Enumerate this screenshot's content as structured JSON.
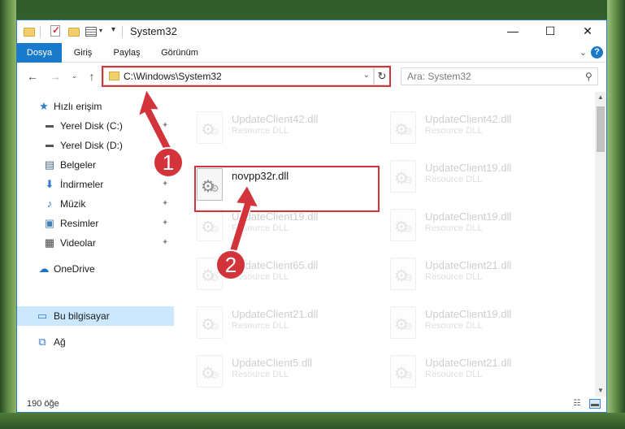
{
  "window": {
    "title": "System32"
  },
  "quick_access_toolbar": {
    "icons": [
      "folder-icon",
      "properties-check-icon",
      "new-folder-icon",
      "properties-list-icon",
      "customize-dropdown-icon"
    ]
  },
  "window_controls": {
    "minimize": "—",
    "maximize": "☐",
    "close": "✕"
  },
  "ribbon": {
    "tabs": [
      {
        "label": "Dosya",
        "active": true
      },
      {
        "label": "Giriş"
      },
      {
        "label": "Paylaş"
      },
      {
        "label": "Görünüm"
      }
    ],
    "expand_chevron": "⌄",
    "help_icon": "?"
  },
  "navigation": {
    "back": "←",
    "forward": "→",
    "recent": "⌄",
    "up": "↑",
    "address_path": "C:\\Windows\\System32",
    "address_dropdown": "⌄",
    "refresh": "↻",
    "search_placeholder": "Ara: System32",
    "search_icon": "⚲"
  },
  "sidebar": {
    "items": [
      {
        "label": "Hızlı erişim",
        "icon": "★",
        "icon_color": "#2e7bd1",
        "pinned": false
      },
      {
        "label": "Yerel Disk (C:)",
        "icon": "▬",
        "icon_color": "#555555",
        "pinned": true
      },
      {
        "label": "Yerel Disk (D:)",
        "icon": "▬",
        "icon_color": "#555555",
        "pinned": true
      },
      {
        "label": "Belgeler",
        "icon": "▤",
        "icon_color": "#4a6a8e",
        "pinned": true
      },
      {
        "label": "İndirmeler",
        "icon": "⬇",
        "icon_color": "#2e7bd1",
        "pinned": true
      },
      {
        "label": "Müzik",
        "icon": "♪",
        "icon_color": "#2e7bd1",
        "pinned": true
      },
      {
        "label": "Resimler",
        "icon": "▣",
        "icon_color": "#4a7fb5",
        "pinned": true
      },
      {
        "label": "Videolar",
        "icon": "▦",
        "icon_color": "#444444",
        "pinned": true
      },
      {
        "label": "OneDrive",
        "icon": "☁",
        "icon_color": "#1e6fc8",
        "pinned": false
      },
      {
        "label": "Bu bilgisayar",
        "icon": "▭",
        "icon_color": "#2e7bd1",
        "pinned": false,
        "selected": true
      },
      {
        "label": "Ağ",
        "icon": "⧉",
        "icon_color": "#2e7bd1",
        "pinned": false
      }
    ],
    "pin_glyph": "📌"
  },
  "files": [
    {
      "name": "UpdateClient42.dll",
      "type": "Resource DLL",
      "faded": true
    },
    {
      "name": "UpdateClient42.dll",
      "type": "Resource DLL",
      "faded": true
    },
    {
      "name": "novpp32r.dll",
      "type": "",
      "faded": false,
      "highlighted": true
    },
    {
      "name": "UpdateClient19.dll",
      "type": "Resource DLL",
      "faded": true
    },
    {
      "name": "UpdateClient19.dll",
      "type": "Resource DLL",
      "faded": true
    },
    {
      "name": "UpdateClient19.dll",
      "type": "Resource DLL",
      "faded": true
    },
    {
      "name": "UpdateClient65.dll",
      "type": "Resource DLL",
      "faded": true
    },
    {
      "name": "UpdateClient21.dll",
      "type": "Resource DLL",
      "faded": true
    },
    {
      "name": "UpdateClient21.dll",
      "type": "Resource DLL",
      "faded": true
    },
    {
      "name": "UpdateClient19.dll",
      "type": "Resource DLL",
      "faded": true
    },
    {
      "name": "UpdateClient5.dll",
      "type": "Resource DLL",
      "faded": true
    },
    {
      "name": "UpdateClient21.dll",
      "type": "Resource DLL",
      "faded": true
    }
  ],
  "status": {
    "item_count": "190 öğe"
  },
  "annotations": {
    "step1": "1",
    "step2": "2",
    "color": "#d3343b"
  }
}
